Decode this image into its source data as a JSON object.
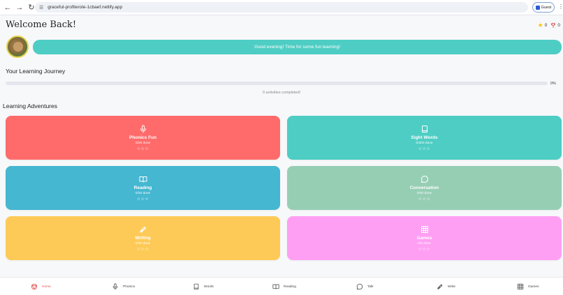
{
  "browser": {
    "url": "graceful-profiterole-1cbaef.netlify.app",
    "profile_label": "Guest"
  },
  "header": {
    "title": "Welcome Back!",
    "stars_count": "0",
    "trophies_count": "0"
  },
  "greeting": "Good evening! Time for some fun learning!",
  "journey": {
    "title": "Your Learning Journey",
    "percent_label": "0%",
    "progress_fraction": 0,
    "activities_label": "0 activities completed!"
  },
  "adventures": {
    "title": "Learning Adventures",
    "cards": [
      {
        "name": "Phonics Fun",
        "done": "0/26 done",
        "stars": "☆☆☆",
        "icon": "microphone-icon",
        "color": "#ff6b6b"
      },
      {
        "name": "Sight Words",
        "done": "0/300 done",
        "stars": "☆☆☆",
        "icon": "book-icon",
        "color": "#4ecdc4"
      },
      {
        "name": "Reading",
        "done": "0/20 done",
        "stars": "☆☆☆",
        "icon": "open-book-icon",
        "color": "#45b7d1"
      },
      {
        "name": "Conversation",
        "done": "0/20 done",
        "stars": "☆☆☆",
        "icon": "chat-bubble-icon",
        "color": "#96ceb4"
      },
      {
        "name": "Writing",
        "done": "0/26 done",
        "stars": "☆☆☆",
        "icon": "pen-icon",
        "color": "#feca57"
      },
      {
        "name": "Games",
        "done": "0/5 done",
        "stars": "☆☆☆",
        "icon": "grid-icon",
        "color": "#ff9ff3"
      }
    ]
  },
  "bottom_nav": [
    {
      "label": "Home",
      "icon": "home-icon",
      "active": true
    },
    {
      "label": "Phonics",
      "icon": "microphone-icon"
    },
    {
      "label": "Words",
      "icon": "book-icon"
    },
    {
      "label": "Reading",
      "icon": "open-book-icon"
    },
    {
      "label": "Talk",
      "icon": "chat-bubble-icon"
    },
    {
      "label": "Write",
      "icon": "pen-icon"
    },
    {
      "label": "Games",
      "icon": "grid-icon"
    }
  ]
}
